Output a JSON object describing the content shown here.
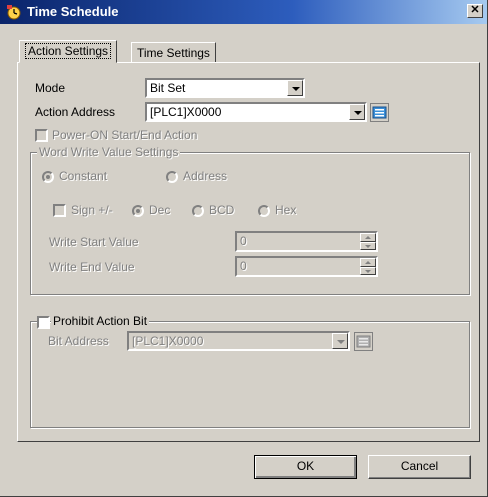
{
  "window": {
    "title": "Time Schedule",
    "close_glyph": "✕"
  },
  "tabs": [
    {
      "label": "Action Settings"
    },
    {
      "label": "Time Settings"
    }
  ],
  "mode": {
    "label": "Mode",
    "value": "Bit Set"
  },
  "action_address": {
    "label": "Action Address",
    "value": "[PLC1]X0000",
    "icon": "address-book-icon"
  },
  "power_on": {
    "label": "Power-ON Start/End Action"
  },
  "word_write": {
    "title": "Word Write Value Settings",
    "constant_label": "Constant",
    "address_label": "Address",
    "sign_label": "Sign +/-",
    "dec_label": "Dec",
    "bcd_label": "BCD",
    "hex_label": "Hex",
    "start_label": "Write Start Value",
    "start_value": "0",
    "end_label": "Write End Value",
    "end_value": "0"
  },
  "prohibit": {
    "label": "Prohibit Action Bit",
    "bit_address_label": "Bit Address",
    "bit_address_value": "[PLC1]X0000"
  },
  "buttons": {
    "ok": "OK",
    "cancel": "Cancel"
  },
  "colors": {
    "titlebar_start": "#0a246a",
    "titlebar_end": "#a6caf0",
    "face": "#d4d0c8",
    "disabled_text": "#808080"
  }
}
